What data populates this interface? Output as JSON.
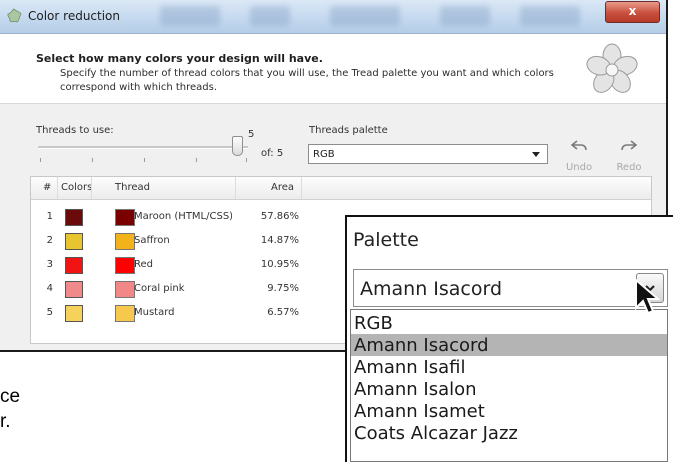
{
  "window": {
    "title": "Color reduction",
    "close_label": "x"
  },
  "header": {
    "title": "Select how many colors your design will have.",
    "description": "Specify the number of thread colors that you will use, the Tread palette you want and which colors correspond with which threads."
  },
  "threads": {
    "label": "Threads to use:",
    "value": "5",
    "of_label": "of: 5",
    "count": 5,
    "max": 5
  },
  "palette": {
    "label": "Threads palette",
    "selected": "RGB"
  },
  "toolbar": {
    "undo_label": "Undo",
    "redo_label": "Redo"
  },
  "table": {
    "columns": [
      "#",
      "Colors",
      "Thread",
      "Area"
    ],
    "rows": [
      {
        "num": "1",
        "color": "#6b0a0a",
        "thread_color": "#7a0000",
        "thread": "Maroon (HTML/CSS)",
        "area": "57.86%"
      },
      {
        "num": "2",
        "color": "#e8c530",
        "thread_color": "#f2b31a",
        "thread": "Saffron",
        "area": "14.87%"
      },
      {
        "num": "3",
        "color": "#f21313",
        "thread_color": "#ff0000",
        "thread": "Red",
        "area": "10.95%"
      },
      {
        "num": "4",
        "color": "#f08a8a",
        "thread_color": "#f28787",
        "thread": "Coral pink",
        "area": "9.75%"
      },
      {
        "num": "5",
        "color": "#f5d35a",
        "thread_color": "#f7c84e",
        "thread": "Mustard",
        "area": "6.57%"
      }
    ]
  },
  "zoom": {
    "title": "Palette",
    "selected": "Amann Isacord",
    "options": [
      "RGB",
      "Amann Isacord",
      "Amann Isafil",
      "Amann Isalon",
      "Amann Isamet",
      "Coats Alcazar Jazz"
    ],
    "highlighted_index": 1
  },
  "background_text": {
    "line1": "ce",
    "line2": "r."
  },
  "colors": {
    "title_bar": "#c6daf0",
    "close": "#c9503e",
    "highlight": "#b4b4b4"
  }
}
